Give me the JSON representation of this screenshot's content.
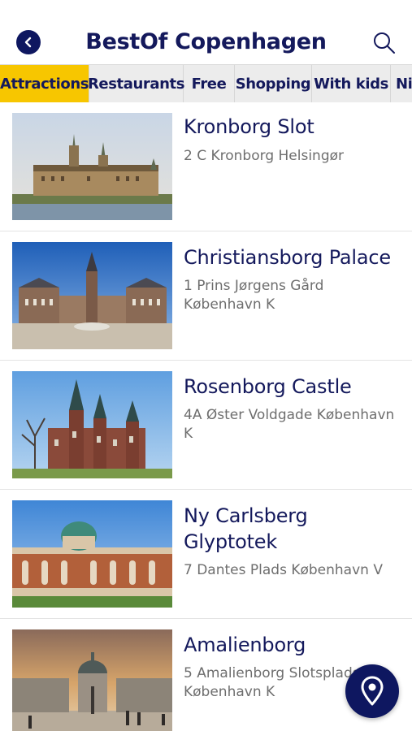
{
  "header": {
    "title": "BestOf Copenhagen",
    "back_icon": "chevron-left-icon",
    "search_icon": "search-icon",
    "accent_color": "#0e1760"
  },
  "tabs": [
    {
      "label": "Attractions",
      "active": true
    },
    {
      "label": "Restaurants",
      "active": false
    },
    {
      "label": "Free",
      "active": false
    },
    {
      "label": "Shopping",
      "active": false
    },
    {
      "label": "With kids",
      "active": false
    },
    {
      "label": "Ni",
      "active": false
    }
  ],
  "tab_active_color": "#f7c600",
  "places": [
    {
      "name": "Kronborg Slot",
      "address": "2 C Kronborg Helsingør"
    },
    {
      "name": "Christiansborg Palace",
      "address": "1 Prins Jørgens Gård København K"
    },
    {
      "name": "Rosenborg Castle",
      "address": "4A Øster Voldgade København K"
    },
    {
      "name": "Ny Carlsberg Glyptotek",
      "address": "7 Dantes Plads København V"
    },
    {
      "name": "Amalienborg",
      "address": "5 Amalienborg Slotsplads København K"
    }
  ],
  "fab": {
    "icon": "map-pin-icon"
  }
}
